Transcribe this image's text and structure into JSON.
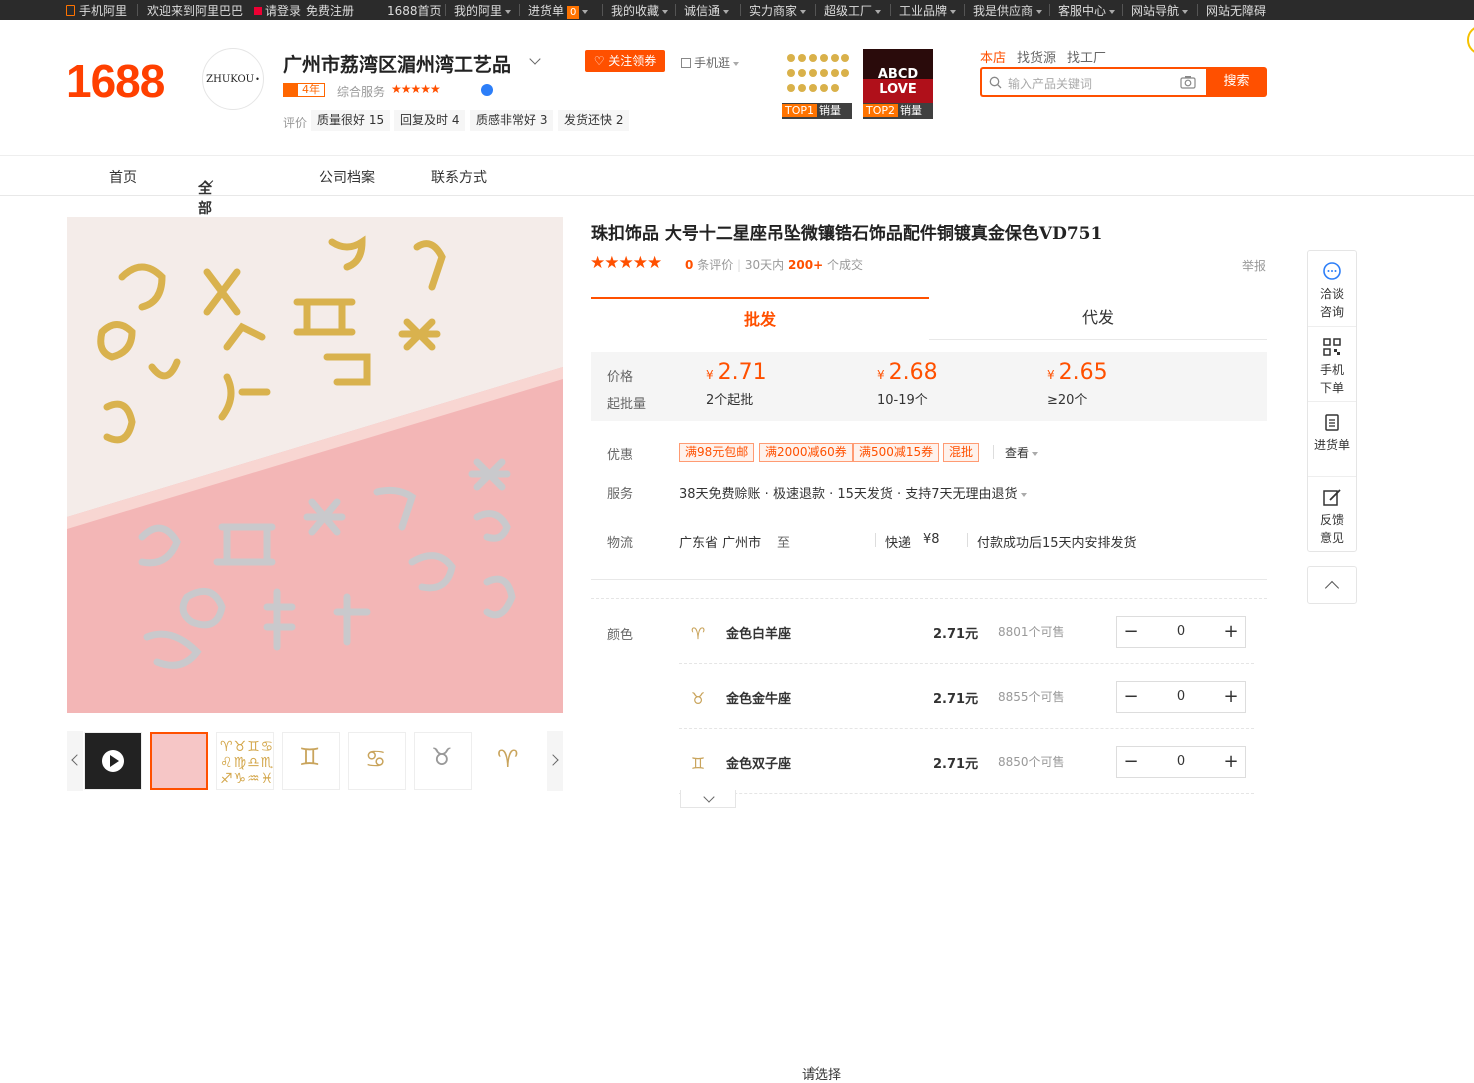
{
  "topbar": {
    "mobile": "手机阿里",
    "welcome": "欢迎来到阿里巴巴",
    "login": "请登录",
    "register": "免费注册",
    "links": [
      "1688首页",
      "我的阿里",
      "进货单",
      "我的收藏",
      "诚信通",
      "实力商家",
      "超级工厂",
      "工业品牌",
      "我是供应商",
      "客服中心",
      "网站导航",
      "网站无障碍"
    ],
    "cart_count": "0"
  },
  "header": {
    "logo": "1688",
    "avatar_text": "ZHUKOU",
    "company_name": "广州市荔湾区湄州湾工艺品",
    "year_badge": "4年",
    "service_label": "综合服务",
    "service_stars": "★★★★★",
    "rating_label": "评价",
    "rating_tags": [
      "质量很好 15",
      "回复及时 4",
      "质感非常好 3",
      "发货还快 2"
    ],
    "follow_button": "关注领券",
    "mobile_shop": "手机逛",
    "top_products": [
      {
        "rank": "TOP1",
        "label": "销量"
      },
      {
        "rank": "TOP2",
        "label": "销量"
      }
    ],
    "top2_image_text": "ABCD LOVE",
    "search_tabs": [
      "本店",
      "找货源",
      "找工厂"
    ],
    "search_placeholder": "输入产品关键词",
    "search_button": "搜索"
  },
  "nav": {
    "items": [
      "首页",
      "全部商品",
      "公司档案",
      "联系方式"
    ]
  },
  "product": {
    "title": "珠扣饰品 大号十二星座吊坠微镶锆石饰品配件铜镀真金保色VD751",
    "stars": "★★★★★",
    "review_count": "0",
    "review_label": "条评价",
    "period": "30天内",
    "sold": "200+",
    "sold_label": "个成交",
    "report": "举报",
    "tabs": [
      "批发",
      "代发"
    ],
    "price_label": "价格",
    "moq_label": "起批量",
    "currency": "¥",
    "price_tiers": [
      {
        "price": "2.71",
        "moq": "2个起批"
      },
      {
        "price": "2.68",
        "moq": "10-19个"
      },
      {
        "price": "2.65",
        "moq": "≥20个"
      }
    ],
    "promo_label": "优惠",
    "coupons": [
      "满98元包邮",
      "满2000减60券",
      "满500减15券",
      "混批"
    ],
    "view_more": "查看",
    "service_label": "服务",
    "service_text": "38天免费赊账 · 极速退款 · 15天发货 · 支持7天无理由退货",
    "logistics_label": "物流",
    "logistics": {
      "origin": "广东省 广州市",
      "to": "至",
      "destination": "请选择",
      "method": "快递",
      "fee": "¥8",
      "ship_note": "付款成功后15天内安排发货"
    },
    "color_label": "颜色",
    "skus": [
      {
        "icon": "♈",
        "name": "金色白羊座",
        "price": "2.71元",
        "stock": "8801个可售",
        "qty": "0"
      },
      {
        "icon": "♉",
        "name": "金色金牛座",
        "price": "2.71元",
        "stock": "8855个可售",
        "qty": "0"
      },
      {
        "icon": "♊",
        "name": "金色双子座",
        "price": "2.71元",
        "stock": "8850个可售",
        "qty": "0"
      }
    ]
  },
  "sidetools": {
    "items": [
      "洽谈咨询",
      "手机下单",
      "进货单",
      "反馈意见"
    ]
  },
  "colors": {
    "brand": "#ff5000",
    "logo": "#ff4000",
    "topbar": "#2b2b2b"
  }
}
